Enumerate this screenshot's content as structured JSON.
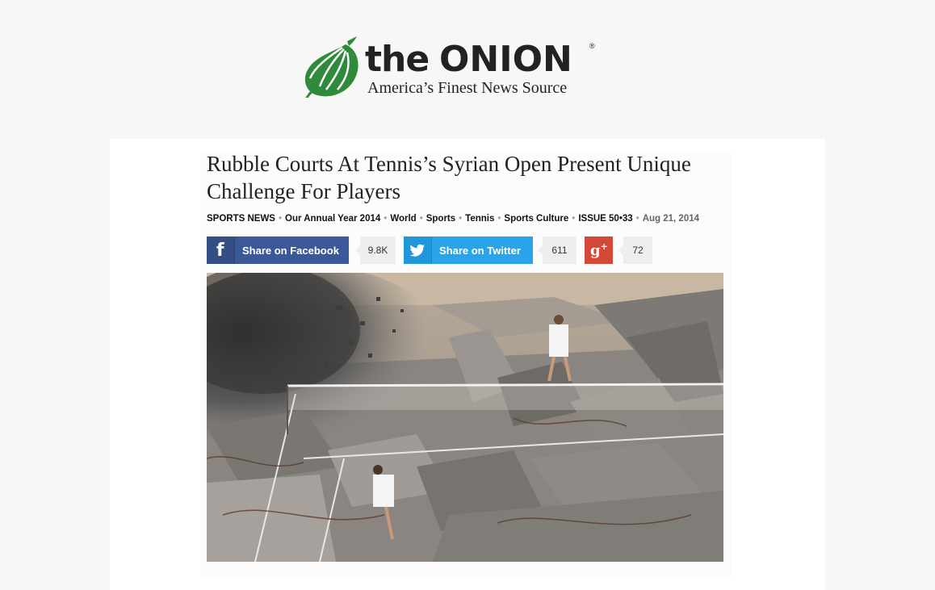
{
  "masthead": {
    "logo_the": "the",
    "logo_onion": "ONION",
    "logo_registered": "®",
    "tagline": "America’s Finest News Source"
  },
  "article": {
    "headline": "Rubble Courts At Tennis’s Syrian Open Present Unique Challenge For Players",
    "meta": {
      "crumbs": [
        "SPORTS NEWS",
        "Our Annual Year 2014",
        "World",
        "Sports",
        "Tennis",
        "Sports Culture",
        "ISSUE 50•33"
      ],
      "separator": "•",
      "date": "Aug 21, 2014"
    },
    "share": {
      "facebook": {
        "label": "Share on Facebook",
        "count": "9.8K",
        "icon": "facebook-icon"
      },
      "twitter": {
        "label": "Share on Twitter",
        "count": "611",
        "icon": "twitter-bird-icon"
      },
      "googleplus": {
        "count": "72",
        "icon": "google-plus-icon"
      }
    }
  },
  "colors": {
    "logo_green": "#2f8a3a",
    "facebook_blue": "#3b5998",
    "twitter_blue": "#2aa4e8",
    "googleplus_red": "#d34836"
  }
}
